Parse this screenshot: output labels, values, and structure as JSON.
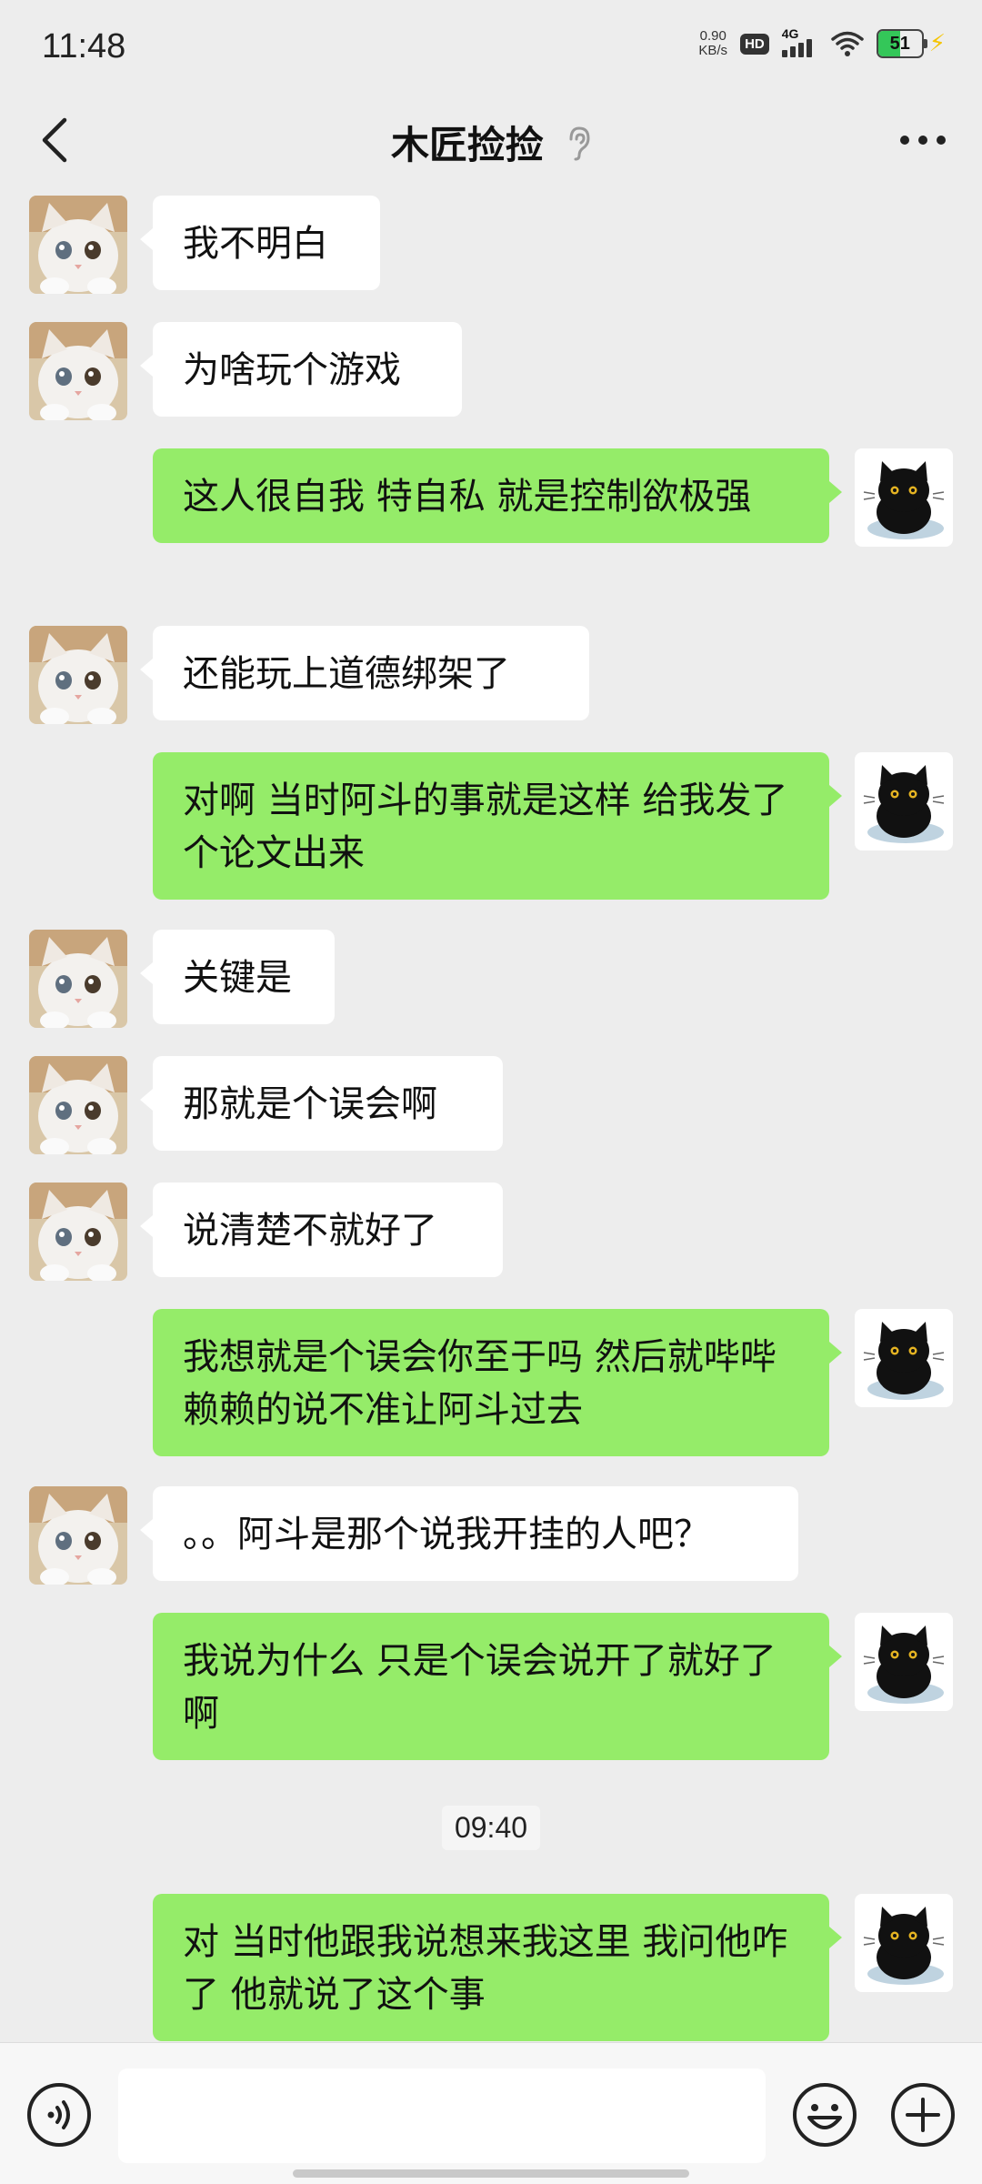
{
  "status_bar": {
    "time": "11:48",
    "net_speed_value": "0.90",
    "net_speed_unit": "KB/s",
    "hd_badge": "HD",
    "network": "4G",
    "battery_level": "51",
    "battery_fraction": 0.51
  },
  "header": {
    "title": "木匠捡捡",
    "icons": {
      "back": "chevron-left-icon",
      "earpiece": "ear-icon",
      "more": "more-dots-icon"
    }
  },
  "messages": [
    {
      "side": "in",
      "avatar": "white-cat",
      "text": "我不明白"
    },
    {
      "side": "in",
      "avatar": "white-cat",
      "text": "为啥玩个游戏"
    },
    {
      "side": "out",
      "avatar": "black-cat",
      "text": "这人很自我 特自私 就是控制欲极强"
    },
    {
      "side": "in",
      "avatar": "white-cat",
      "text": "还能玩上道德绑架了"
    },
    {
      "side": "out",
      "avatar": "black-cat",
      "text": "对啊 当时阿斗的事就是这样 给我发了个论文出来"
    },
    {
      "side": "in",
      "avatar": "white-cat",
      "text": "关键是"
    },
    {
      "side": "in",
      "avatar": "white-cat",
      "text": "那就是个误会啊"
    },
    {
      "side": "in",
      "avatar": "white-cat",
      "text": "说清楚不就好了"
    },
    {
      "side": "out",
      "avatar": "black-cat",
      "text": "我想就是个误会你至于吗 然后就哔哔赖赖的说不准让阿斗过去"
    },
    {
      "side": "in",
      "avatar": "white-cat",
      "text": "。。阿斗是那个说我开挂的人吧？"
    },
    {
      "side": "out",
      "avatar": "black-cat",
      "text": "我说为什么 只是个误会说开了就好了啊"
    },
    {
      "side": "out",
      "avatar": "black-cat",
      "text": "对 当时他跟我说想来我这里 我问他咋了 他就说了这个事"
    }
  ],
  "timestamp": "09:40",
  "input_bar": {
    "placeholder": "",
    "icons": {
      "voice": "voice-icon",
      "emoji": "emoji-icon",
      "plus": "plus-icon"
    }
  },
  "colors": {
    "background": "#ededed",
    "outgoing_bubble": "#95ec69",
    "incoming_bubble": "#ffffff",
    "battery_fill": "#34c759"
  }
}
